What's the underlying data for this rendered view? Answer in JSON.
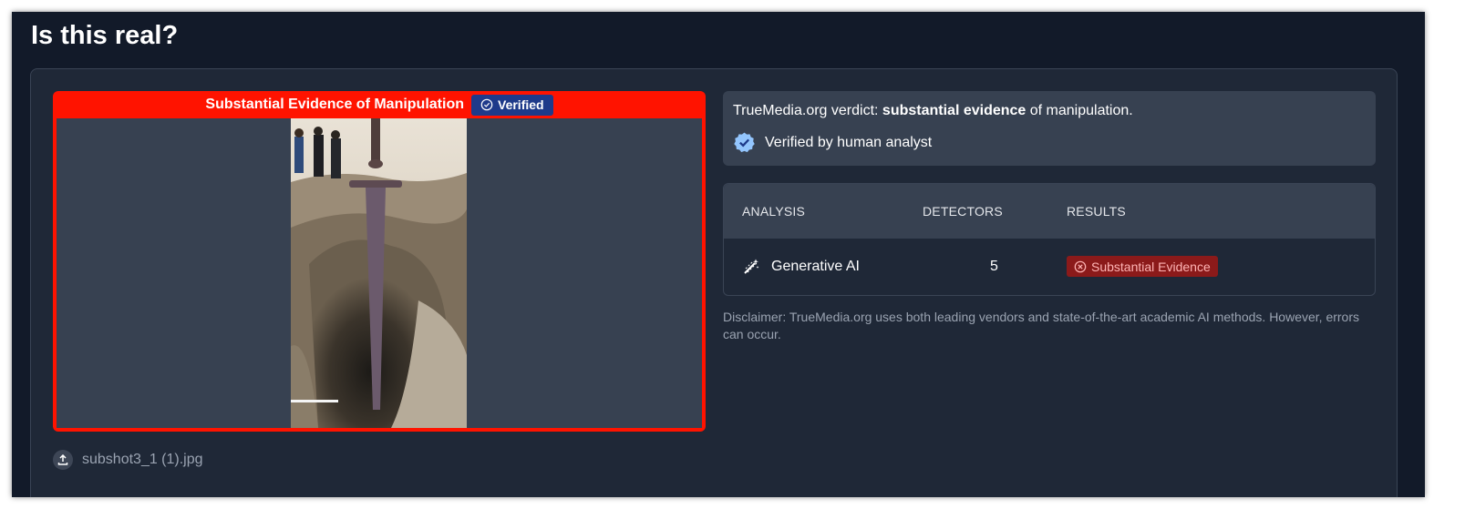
{
  "page": {
    "title": "Is this real?"
  },
  "media": {
    "banner_text": "Substantial Evidence of Manipulation",
    "verified_label": "Verified",
    "banner_color": "#ff1300",
    "file_name": "subshot3_1 (1).jpg"
  },
  "verdict": {
    "prefix": "TrueMedia.org verdict: ",
    "emphasis": "substantial evidence",
    "suffix": " of manipulation.",
    "analyst_text": "Verified by human analyst"
  },
  "analysis": {
    "headers": {
      "analysis": "ANALYSIS",
      "detectors": "DETECTORS",
      "results": "RESULTS"
    },
    "rows": [
      {
        "icon": "magic-wand-icon",
        "name": "Generative AI",
        "detectors": "5",
        "result": "Substantial Evidence",
        "result_color": "#8b1a1a"
      }
    ]
  },
  "disclaimer": "Disclaimer: TrueMedia.org uses both leading vendors and state-of-the-art academic AI methods. However, errors can occur."
}
